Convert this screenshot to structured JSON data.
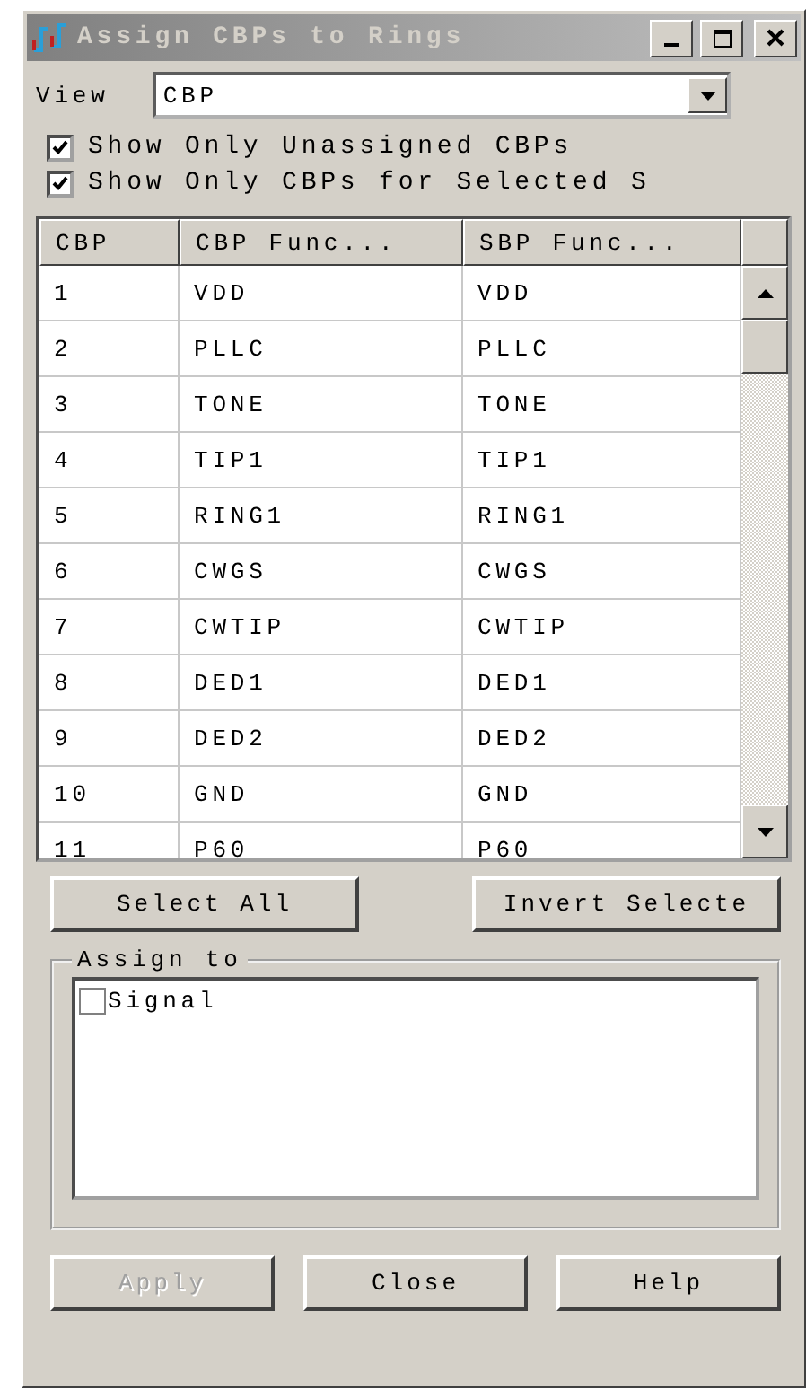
{
  "window": {
    "title": "Assign CBPs to Rings"
  },
  "view": {
    "label": "View",
    "value": "CBP"
  },
  "options": [
    {
      "label": "Show Only Unassigned CBPs",
      "checked": true
    },
    {
      "label": "Show Only CBPs for Selected S",
      "checked": true
    }
  ],
  "table": {
    "columns": [
      "CBP",
      "CBP Func...",
      "SBP Func..."
    ],
    "rows": [
      [
        "1",
        "VDD",
        "VDD"
      ],
      [
        "2",
        "PLLC",
        "PLLC"
      ],
      [
        "3",
        "TONE",
        "TONE"
      ],
      [
        "4",
        "TIP1",
        "TIP1"
      ],
      [
        "5",
        "RING1",
        "RING1"
      ],
      [
        "6",
        "CWGS",
        "CWGS"
      ],
      [
        "7",
        "CWTIP",
        "CWTIP"
      ],
      [
        "8",
        "DED1",
        "DED1"
      ],
      [
        "9",
        "DED2",
        "DED2"
      ],
      [
        "10",
        "GND",
        "GND"
      ],
      [
        "11",
        "P60",
        "P60"
      ]
    ]
  },
  "selection_buttons": [
    "Select All",
    "Invert Selecte"
  ],
  "assign_group": {
    "title": "Assign to",
    "items": [
      {
        "label": "Signal",
        "checked": false
      }
    ]
  },
  "buttons": [
    {
      "label": "Apply",
      "disabled": true
    },
    {
      "label": "Close",
      "disabled": false
    },
    {
      "label": "Help",
      "disabled": false
    }
  ]
}
